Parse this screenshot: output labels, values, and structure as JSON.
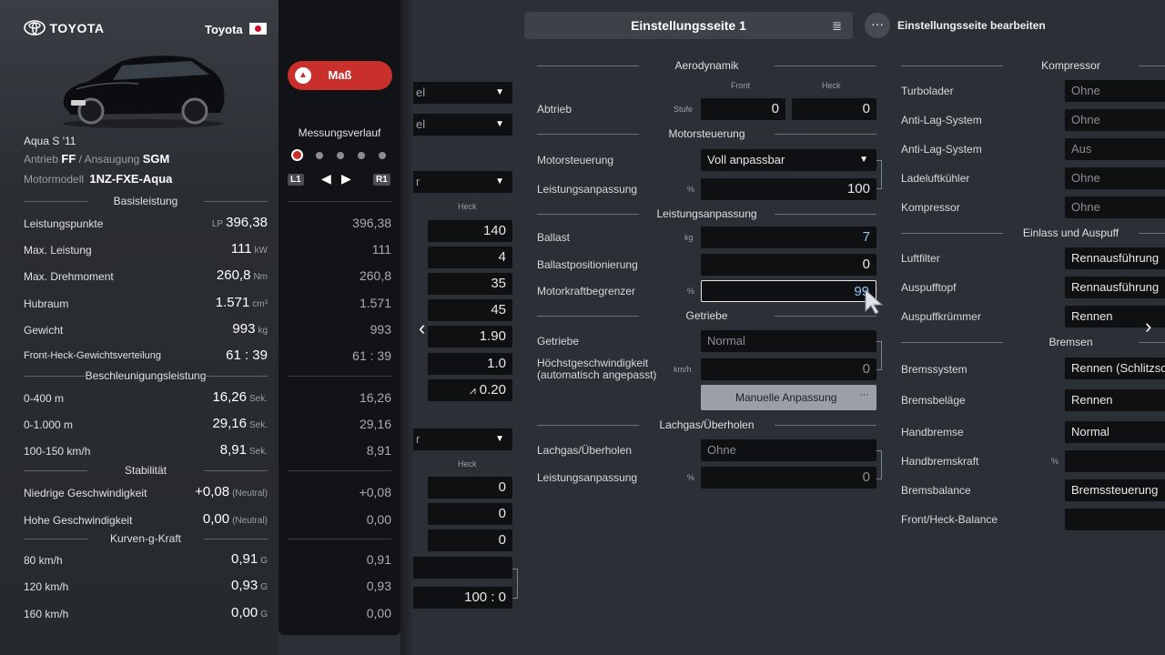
{
  "header": {
    "page_title": "Einstellungsseite 1",
    "edit_label": "Einstellungsseite bearbeiten"
  },
  "car": {
    "brand_logo_text": "TOYOTA",
    "maker": "Toyota",
    "model": "Aqua S '11",
    "drive_label": "Antrieb",
    "drive_value": "FF",
    "aspiration_label": "Ansaugung",
    "aspiration_value": "SGM",
    "engine_label": "Motormodell",
    "engine_value": "1NZ-FXE-Aqua"
  },
  "measure": {
    "button_label": "Maß",
    "history_label": "Messungsverlauf",
    "l1": "L1",
    "r1": "R1"
  },
  "stats": {
    "basis_title": "Basisleistung",
    "pp_label": "Leistungspunkte",
    "pp_prefix": "LP",
    "pp_value": "396,38",
    "pp_hist": "396,38",
    "power_label": "Max. Leistung",
    "power_value": "111",
    "power_unit": "kW",
    "power_hist": "111",
    "torque_label": "Max. Drehmoment",
    "torque_value": "260,8",
    "torque_unit": "Nm",
    "torque_hist": "260,8",
    "disp_label": "Hubraum",
    "disp_value": "1.571",
    "disp_unit": "cm³",
    "disp_hist": "1.571",
    "weight_label": "Gewicht",
    "weight_value": "993",
    "weight_unit": "kg",
    "weight_hist": "993",
    "dist_label": "Front-Heck-Gewichtsverteilung",
    "dist_value": "61 : 39",
    "dist_hist": "61 : 39",
    "accel_title": "Beschleunigungsleistung",
    "a400_label": "0-400 m",
    "a400_value": "16,26",
    "a400_unit": "Sek.",
    "a400_hist": "16,26",
    "a1000_label": "0-1.000 m",
    "a1000_value": "29,16",
    "a1000_unit": "Sek.",
    "a1000_hist": "29,16",
    "a100_label": "100-150 km/h",
    "a100_value": "8,91",
    "a100_unit": "Sek.",
    "a100_hist": "8,91",
    "stab_title": "Stabilität",
    "low_label": "Niedrige Geschwindigkeit",
    "low_value": "+0,08",
    "low_unit": "(Neutral)",
    "low_hist": "+0,08",
    "high_label": "Hohe Geschwindigkeit",
    "high_value": "0,00",
    "high_unit": "(Neutral)",
    "high_hist": "0,00",
    "g_title": "Kurven-g-Kraft",
    "g80_label": "80 km/h",
    "g80_value": "0,91",
    "g80_unit": "G",
    "g80_hist": "0,91",
    "g120_label": "120 km/h",
    "g120_value": "0,93",
    "g120_unit": "G",
    "g120_hist": "0,93",
    "g160_label": "160 km/h",
    "g160_value": "0,00",
    "g160_unit": "G",
    "g160_hist": "0,00"
  },
  "col1": {
    "sel1": "el",
    "sel2": "el",
    "sel3": "r",
    "heck1": "Heck",
    "v1": "140",
    "v2": "4",
    "v3": "35",
    "v4": "45",
    "v5": "1.90",
    "v6": "1.0",
    "v7": "0.20",
    "sel4": "r",
    "heck2": "Heck",
    "w1": "0",
    "w2": "0",
    "w3": "0",
    "ratio": "100 : 0"
  },
  "col2": {
    "aero_title": "Aerodynamik",
    "front": "Front",
    "heck": "Heck",
    "abtrieb_label": "Abtrieb",
    "abtrieb_unit": "Stufe",
    "abtrieb_front": "0",
    "abtrieb_heck": "0",
    "motor_title": "Motorsteuerung",
    "motor_label": "Motorsteuerung",
    "motor_value": "Voll anpassbar",
    "la_label": "Leistungsanpassung",
    "la_unit": "%",
    "la_value": "100",
    "perf_title": "Leistungsanpassung",
    "ballast_label": "Ballast",
    "ballast_unit": "kg",
    "ballast_value": "7",
    "bpos_label": "Ballastpositionierung",
    "bpos_value": "0",
    "mkb_label": "Motorkraftbegrenzer",
    "mkb_unit": "%",
    "mkb_value": "99",
    "getriebe_title": "Getriebe",
    "getriebe_label": "Getriebe",
    "getriebe_value": "Normal",
    "hg_label1": "Höchstgeschwindigkeit",
    "hg_label2": "(automatisch angepasst)",
    "hg_unit": "km/h",
    "hg_value": "0",
    "manual_label": "Manuelle Anpassung",
    "nitro_title": "Lachgas/Überholen",
    "nitro_label": "Lachgas/Überholen",
    "nitro_value": "Ohne",
    "nla_label": "Leistungsanpassung",
    "nla_unit": "%",
    "nla_value": "0"
  },
  "col3": {
    "komp_title": "Kompressor",
    "turbo_label": "Turbolader",
    "turbo_value": "Ohne",
    "als1_label": "Anti-Lag-System",
    "als1_value": "Ohne",
    "als2_label": "Anti-Lag-System",
    "als2_value": "Aus",
    "llk_label": "Ladeluftkühler",
    "llk_value": "Ohne",
    "komp_label": "Kompressor",
    "komp_value": "Ohne",
    "intake_title": "Einlass und Auspuff",
    "filter_label": "Luftfilter",
    "filter_value": "Rennausführung",
    "topf_label": "Auspufftopf",
    "topf_value": "Rennausführung",
    "kruemmer_label": "Auspuffkrümmer",
    "kruemmer_value": "Rennen",
    "brake_title": "Bremsen",
    "bsys_label": "Bremssystem",
    "bsys_value": "Rennen (Schlitzsch",
    "belag_label": "Bremsbeläge",
    "belag_value": "Rennen",
    "hand_label": "Handbremse",
    "hand_value": "Normal",
    "hkraft_label": "Handbremskraft",
    "hkraft_unit": "%",
    "hkraft_value": "",
    "bbal_label": "Bremsbalance",
    "bbal_value": "Bremssteuerung",
    "fhb_label": "Front/Heck-Balance",
    "fhb_value": ""
  }
}
